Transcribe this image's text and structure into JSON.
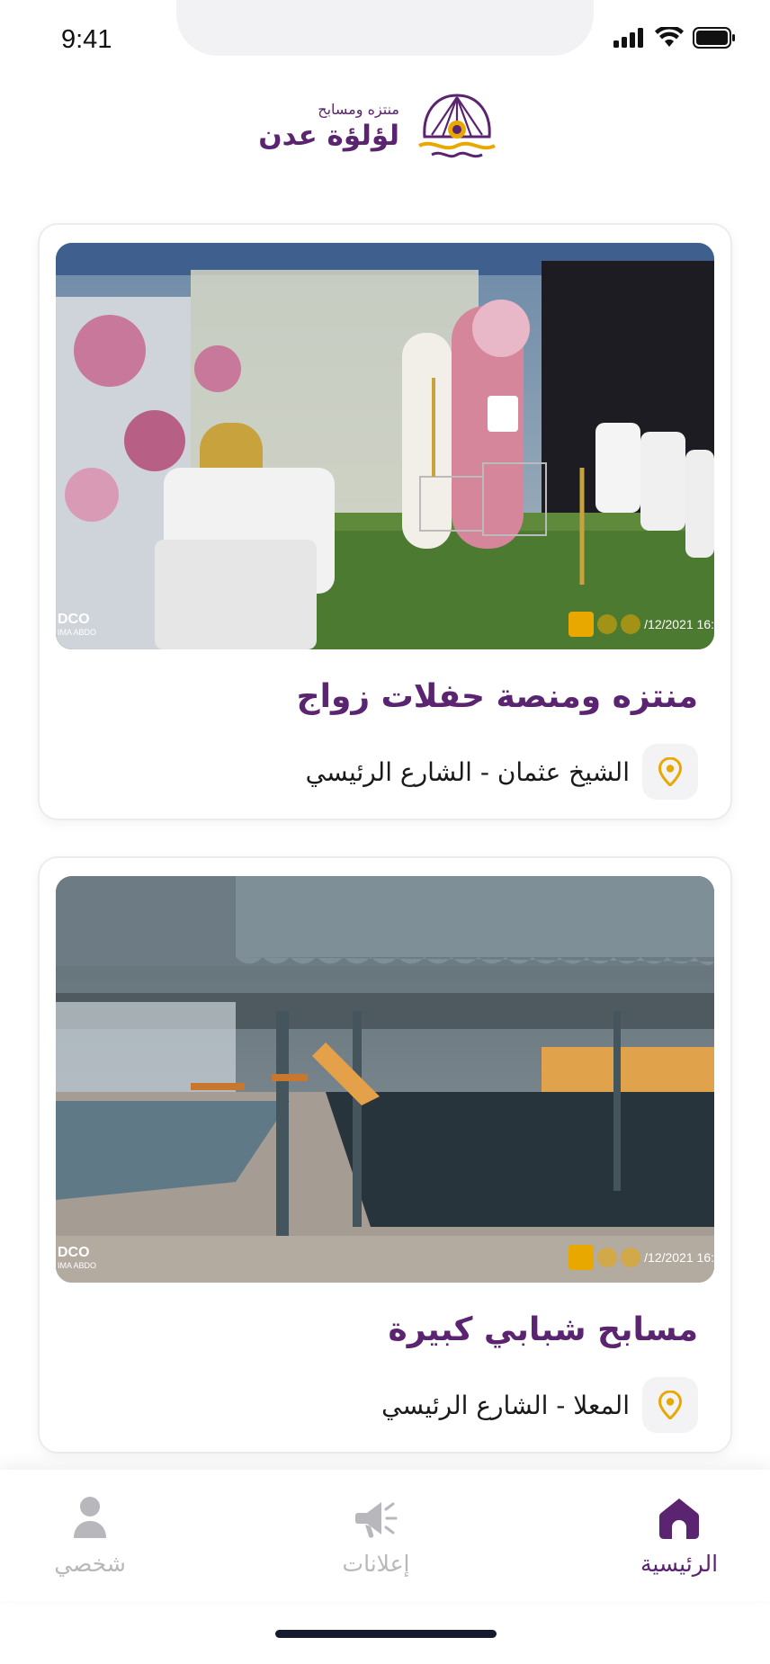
{
  "status_bar": {
    "time": "9:41"
  },
  "header": {
    "logo_subtitle": "منتزه ومسابح",
    "logo_title": "لؤلؤة عدن"
  },
  "listings": [
    {
      "title": "منتزه ومنصة حفلات زواج",
      "location": "الشيخ عثمان - الشارع الرئيسي",
      "photo_watermark": "DCO",
      "photo_watermark_sub": "IMA ABDO",
      "photo_date": "/12/2021 16:"
    },
    {
      "title": "مسابح شبابي كبيرة",
      "location": "المعلا - الشارع الرئيسي",
      "photo_watermark": "DCO",
      "photo_watermark_sub": "IMA ABDO",
      "photo_date": "/12/2021 16:"
    }
  ],
  "tab_bar": {
    "home_label": "الرئيسية",
    "ads_label": "إعلانات",
    "profile_label": "شخصي",
    "active_tab": "home"
  },
  "colors": {
    "brand_purple": "#5a2470",
    "accent_gold": "#e9a800",
    "inactive_gray": "#b7b7bc"
  },
  "icons": {
    "location": "map-pin-icon",
    "home": "home-icon",
    "ads": "megaphone-icon",
    "profile": "person-icon"
  }
}
